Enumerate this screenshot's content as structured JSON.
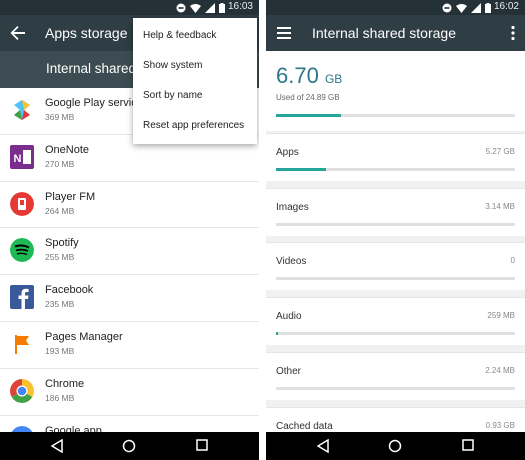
{
  "left": {
    "status_time": "16:03",
    "title": "Apps storage",
    "volume": "Internal shared",
    "menu": [
      "Help & feedback",
      "Show system",
      "Sort by name",
      "Reset app preferences"
    ],
    "apps": [
      {
        "name": "Google Play services",
        "size": "369 MB",
        "icon": "google-play-services-icon",
        "color": "#4fc3f7"
      },
      {
        "name": "OneNote",
        "size": "270 MB",
        "icon": "onenote-icon",
        "color": "#7b2d8e"
      },
      {
        "name": "Player FM",
        "size": "264 MB",
        "icon": "player-fm-icon",
        "color": "#e53935"
      },
      {
        "name": "Spotify",
        "size": "255 MB",
        "icon": "spotify-icon",
        "color": "#1db954"
      },
      {
        "name": "Facebook",
        "size": "235 MB",
        "icon": "facebook-icon",
        "color": "#3b5998"
      },
      {
        "name": "Pages Manager",
        "size": "193 MB",
        "icon": "pages-manager-icon",
        "color": "#f57c00"
      },
      {
        "name": "Chrome",
        "size": "186 MB",
        "icon": "chrome-icon",
        "color": "#db4437"
      },
      {
        "name": "Google app",
        "size": "",
        "icon": "google-app-icon",
        "color": "#4285f4"
      }
    ]
  },
  "right": {
    "status_time": "16:02",
    "title": "Internal shared storage",
    "used_value": "6.70",
    "used_unit": "GB",
    "used_of": "Used of 24.89 GB",
    "used_fraction": 0.27,
    "categories": [
      {
        "label": "Apps",
        "value": "5.27 GB",
        "fraction": 0.21
      },
      {
        "label": "Images",
        "value": "3.14 MB",
        "fraction": 0
      },
      {
        "label": "Videos",
        "value": "0",
        "fraction": 0
      },
      {
        "label": "Audio",
        "value": "259 MB",
        "fraction": 0.01
      },
      {
        "label": "Other",
        "value": "2.24 MB",
        "fraction": 0
      },
      {
        "label": "Cached data",
        "value": "0.93 GB",
        "fraction": 0.04
      }
    ]
  },
  "colors": {
    "appbar": "#2f3d44",
    "statusbar": "#243238",
    "accent": "#26a69a",
    "storage_text": "#2d7787"
  }
}
